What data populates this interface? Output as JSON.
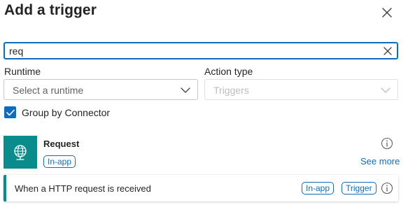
{
  "panel": {
    "title": "Add a trigger"
  },
  "search": {
    "value": "req",
    "placeholder": ""
  },
  "filters": {
    "runtime_label": "Runtime",
    "runtime_placeholder": "Select a runtime",
    "action_type_label": "Action type",
    "action_type_value": "Triggers"
  },
  "group_by": {
    "label": "Group by Connector",
    "checked": true
  },
  "connector": {
    "name": "Request",
    "badge": "In-app",
    "see_more": "See more"
  },
  "actions": [
    {
      "label": "When a HTTP request is received",
      "badges": [
        "In-app",
        "Trigger"
      ]
    }
  ],
  "colors": {
    "accent": "#0f6cbd",
    "connector": "#0a8c8c"
  },
  "icons": {
    "close": "close-icon",
    "clear": "clear-search-icon",
    "chevron": "chevron-down-icon",
    "check": "checkmark-icon",
    "connector": "request-globe-icon",
    "info": "info-icon"
  }
}
